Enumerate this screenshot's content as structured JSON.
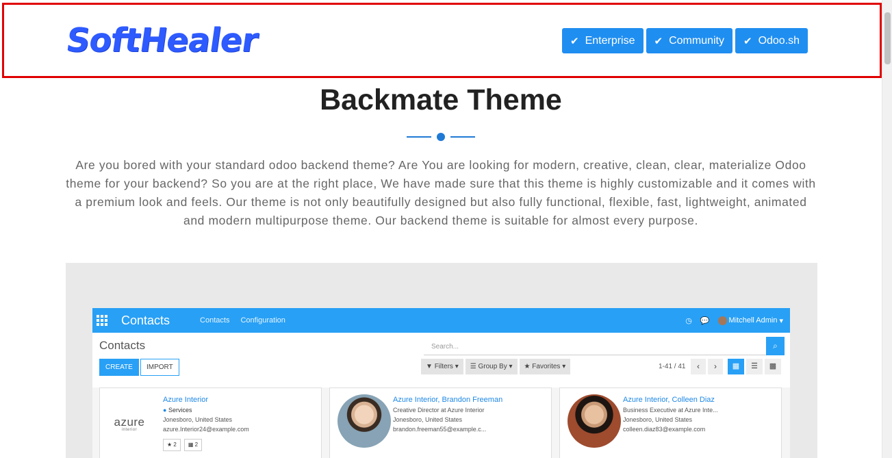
{
  "logo": {
    "text": "SoftHealer"
  },
  "versions": [
    {
      "label": "Enterprise",
      "icon": "check-icon"
    },
    {
      "label": "Community",
      "icon": "check-icon"
    },
    {
      "label": "Odoo.sh",
      "icon": "check-icon"
    }
  ],
  "section": {
    "title": "Backmate Theme",
    "description": "Are you bored with your standard odoo backend theme? Are You are looking for modern, creative, clean, clear, materialize Odoo theme for your backend? So you are at the right place, We have made sure that this theme is highly customizable and it comes with a premium look and feels. Our theme is not only beautifully designed but also fully functional, flexible, fast, lightweight, animated and modern multipurpose theme. Our backend theme is suitable for almost every purpose."
  },
  "app": {
    "name": "Contacts",
    "menu": [
      "Contacts",
      "Configuration"
    ],
    "user": "Mitchell Admin",
    "breadcrumb": "Contacts",
    "create_label": "CREATE",
    "import_label": "IMPORT",
    "search_placeholder": "Search...",
    "filters": [
      "Filters",
      "Group By",
      "Favorites"
    ],
    "pager": "1-41 / 41",
    "colors": {
      "primary": "#28a0f5"
    }
  },
  "contacts": [
    {
      "name": "Azure Interior",
      "tag": "Services",
      "location": "Jonesboro, United States",
      "email": "azure.Interior24@example.com",
      "logo_text": "azure",
      "logo_sub": "interior",
      "badges": [
        "2",
        "2"
      ]
    },
    {
      "name": "Azure Interior, Brandon Freeman",
      "title": "Creative Director at Azure Interior",
      "location": "Jonesboro, United States",
      "email": "brandon.freeman55@example.c..."
    },
    {
      "name": "Azure Interior, Colleen Diaz",
      "title": "Business Executive at Azure Inte...",
      "location": "Jonesboro, United States",
      "email": "colleen.diaz83@example.com"
    }
  ]
}
